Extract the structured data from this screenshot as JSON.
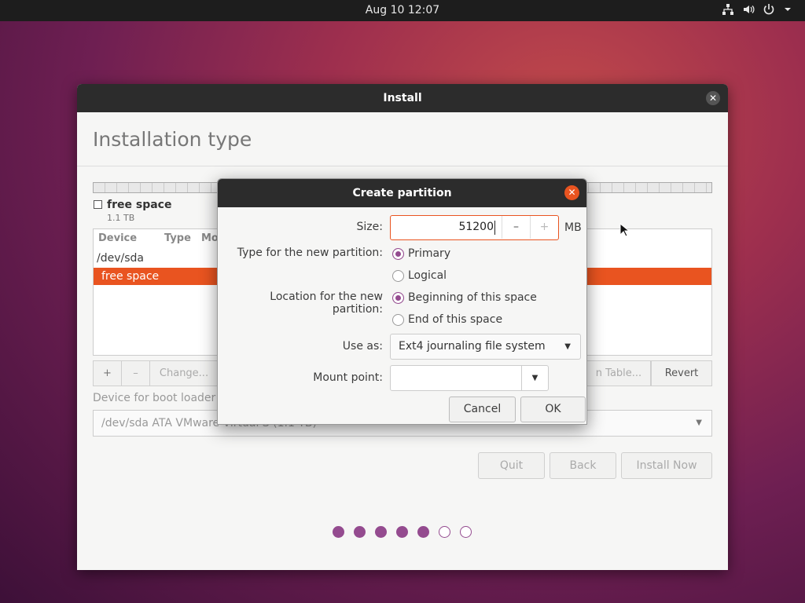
{
  "topbar": {
    "clock": "Aug 10  12:07",
    "icons": [
      "network-icon",
      "volume-icon",
      "power-icon",
      "menu-arrow-icon"
    ]
  },
  "window": {
    "title": "Install",
    "page_title": "Installation type",
    "legend": {
      "name": "free space",
      "size": "1.1 TB"
    },
    "table": {
      "headers": [
        "Device",
        "Type",
        "Mo"
      ],
      "rows": [
        {
          "device": "/dev/sda",
          "selected": false
        },
        {
          "device": "free space",
          "selected": true
        }
      ]
    },
    "toolbar": {
      "add": "+",
      "remove": "–",
      "change": "Change...",
      "new_table": "n Table...",
      "revert": "Revert"
    },
    "boot_loader": {
      "label": "Device for boot loader i",
      "value": "/dev/sda ATA VMware Virtual S (1.1 TB)"
    },
    "nav": {
      "quit": "Quit",
      "back": "Back",
      "install": "Install Now"
    },
    "progress": {
      "total": 7,
      "done": 5
    },
    "accent": "#e95420",
    "aubergine": "#944b8f"
  },
  "dialog": {
    "title": "Create partition",
    "size_label": "Size:",
    "size_value": "51200",
    "size_minus": "–",
    "size_plus": "+",
    "size_unit": "MB",
    "type_label": "Type for the new partition:",
    "type_options": [
      {
        "label": "Primary",
        "checked": true
      },
      {
        "label": "Logical",
        "checked": false
      }
    ],
    "location_label": "Location for the new partition:",
    "location_options": [
      {
        "label": "Beginning of this space",
        "checked": true
      },
      {
        "label": "End of this space",
        "checked": false
      }
    ],
    "use_as_label": "Use as:",
    "use_as_value": "Ext4 journaling file system",
    "mount_label": "Mount point:",
    "mount_value": "",
    "cancel": "Cancel",
    "ok": "OK"
  }
}
